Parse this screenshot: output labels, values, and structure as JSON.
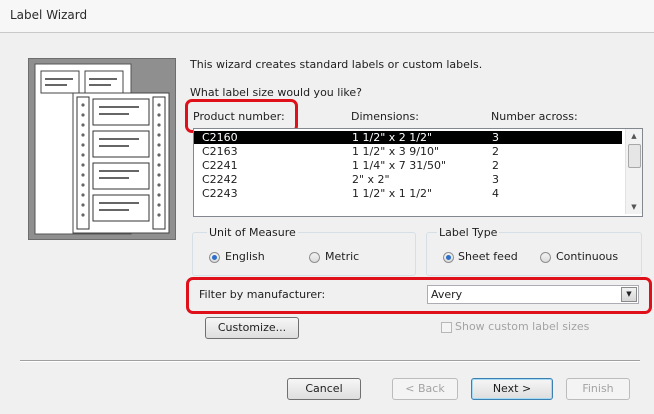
{
  "window": {
    "title": "Label Wizard"
  },
  "intro": {
    "line1": "This wizard creates standard labels or custom labels.",
    "line2": "What label size would you like?"
  },
  "table": {
    "headers": [
      "Product number:",
      "Dimensions:",
      "Number across:"
    ],
    "rows": [
      {
        "product": "C2160",
        "dimensions": "1 1/2\" x 2 1/2\"",
        "across": "3",
        "selected": true
      },
      {
        "product": "C2163",
        "dimensions": "1 1/2\" x 3 9/10\"",
        "across": "2"
      },
      {
        "product": "C2241",
        "dimensions": "1 1/4\" x 7 31/50\"",
        "across": "2"
      },
      {
        "product": "C2242",
        "dimensions": "2\" x 2\"",
        "across": "3"
      },
      {
        "product": "C2243",
        "dimensions": "1 1/2\" x 1 1/2\"",
        "across": "4"
      }
    ]
  },
  "unit_of_measure": {
    "label": "Unit of Measure",
    "options": [
      {
        "label": "English",
        "selected": true
      },
      {
        "label": "Metric",
        "selected": false
      }
    ]
  },
  "label_type": {
    "label": "Label Type",
    "options": [
      {
        "label": "Sheet feed",
        "selected": true
      },
      {
        "label": "Continuous",
        "selected": false
      }
    ]
  },
  "filter": {
    "label": "Filter by manufacturer:",
    "value": "Avery"
  },
  "customize_label": "Customize...",
  "show_custom_label": "Show custom label sizes",
  "footer": {
    "cancel": "Cancel",
    "back": "< Back",
    "next": "Next >",
    "finish": "Finish"
  },
  "colors": {
    "highlight": "#e0101a",
    "selection": "#000000",
    "radio_dot": "#2c6fc8"
  }
}
